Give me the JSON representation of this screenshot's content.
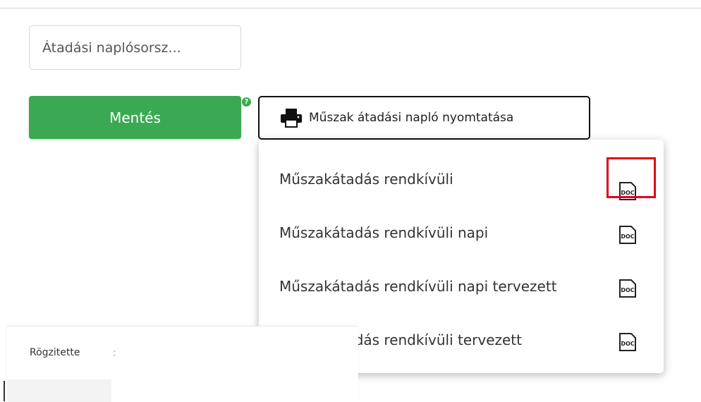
{
  "form": {
    "log_number_placeholder": "Átadási naplósorsz...",
    "save_label": "Mentés",
    "help_mark": "?",
    "print_label": "Műszak átadási napló nyomtatása"
  },
  "print_menu": {
    "items": [
      {
        "label": "Műszakátadás rendkívüli",
        "icon": "doc-file-icon",
        "highlighted": true
      },
      {
        "label": "Műszakátadás rendkívüli napi",
        "icon": "doc-file-icon",
        "highlighted": false
      },
      {
        "label": "Műszakátadás rendkívüli napi tervezett",
        "icon": "doc-file-icon",
        "highlighted": false
      },
      {
        "label": "Műszakátadás rendkívüli tervezett",
        "icon": "doc-file-icon",
        "highlighted": false
      }
    ],
    "doc_badge_text": "DOC"
  },
  "details": {
    "recorded_by_label": "Rögzitette",
    "separator": ":"
  },
  "colors": {
    "save_green": "#3ba954",
    "highlight_red": "#e0001b"
  }
}
